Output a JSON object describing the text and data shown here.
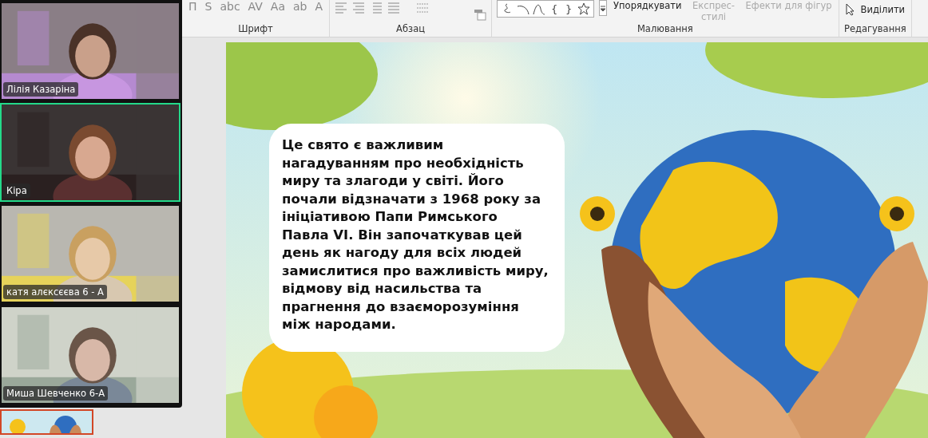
{
  "participants": [
    {
      "name": "Лілія Казаріна",
      "active": false
    },
    {
      "name": "Кіра",
      "active": true
    },
    {
      "name": "катя алєксєєва 6 - А",
      "active": false
    },
    {
      "name": "Миша Шевченко 6-А",
      "active": false
    }
  ],
  "thumbnail": {
    "selected": true
  },
  "ribbon": {
    "groups": [
      {
        "label": "Шрифт",
        "kind": "font",
        "glyphs": [
          "П",
          "S",
          "abc",
          "AV",
          "Aa",
          "ab",
          "A"
        ]
      },
      {
        "label": "Абзац",
        "kind": "paragraph"
      },
      {
        "label": "Малювання",
        "kind": "drawing",
        "shapes": [
          {
            "kind": "scribble"
          },
          {
            "kind": "arc"
          },
          {
            "kind": "wave"
          },
          {
            "kind": "glyph",
            "text": "{"
          },
          {
            "kind": "glyph",
            "text": "}"
          },
          {
            "kind": "star"
          }
        ],
        "buttons": [
          {
            "label": "Упорядкувати",
            "disabled": false
          },
          {
            "label": "Експрес-стилі",
            "disabled": true
          },
          {
            "label": "Ефекти для фігур",
            "disabled": true
          }
        ]
      },
      {
        "label": "Редагування",
        "kind": "editing",
        "buttons": [
          {
            "label": "Виділити",
            "disabled": false
          }
        ]
      }
    ]
  },
  "slide": {
    "text": "Це свято є важливим нагадуванням про необхідність миру та злагоди у світі. Його почали відзначати з 1968 року за ініціативою Папи Римського Павла VI. Він започаткував цей день як нагоду для всіх людей замислитися про важливість миру, відмову від насильства та прагнення до взаєморозуміння між народами."
  }
}
